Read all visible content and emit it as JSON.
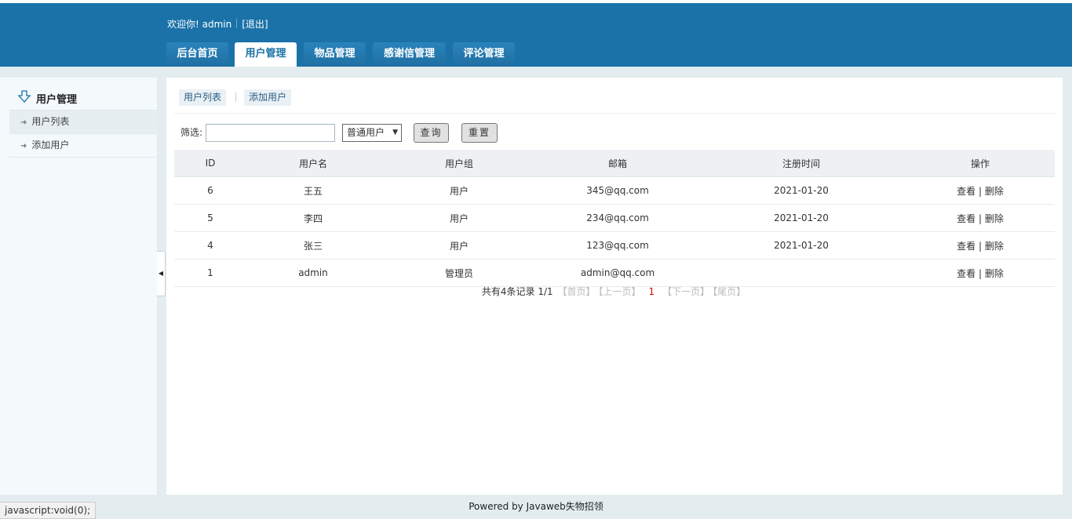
{
  "header": {
    "welcome": "欢迎你! admin",
    "logout": "[退出]",
    "tabs": [
      {
        "label": "后台首页"
      },
      {
        "label": "用户管理"
      },
      {
        "label": "物品管理"
      },
      {
        "label": "感谢信管理"
      },
      {
        "label": "评论管理"
      }
    ],
    "active_tab": "用户管理"
  },
  "sidebar": {
    "title": "用户管理",
    "items": [
      {
        "label": "用户列表"
      },
      {
        "label": "添加用户"
      }
    ]
  },
  "main": {
    "subtabs": [
      {
        "label": "用户列表"
      },
      {
        "label": "添加用户"
      }
    ],
    "filter": {
      "label": "筛选:",
      "input_value": "",
      "select_value": "普通用户",
      "query_button": "查询",
      "reset_button": "重置"
    },
    "table": {
      "columns": [
        "ID",
        "用户名",
        "用户组",
        "邮箱",
        "注册时间",
        "操作"
      ],
      "rows": [
        {
          "id": "6",
          "username": "王五",
          "group": "用户",
          "email": "345@qq.com",
          "date": "2021-01-20"
        },
        {
          "id": "5",
          "username": "李四",
          "group": "用户",
          "email": "234@qq.com",
          "date": "2021-01-20"
        },
        {
          "id": "4",
          "username": "张三",
          "group": "用户",
          "email": "123@qq.com",
          "date": "2021-01-20"
        },
        {
          "id": "1",
          "username": "admin",
          "group": "管理员",
          "email": "admin@qq.com",
          "date": ""
        }
      ],
      "action_view": "查看",
      "action_sep": "|",
      "action_delete": "删除"
    },
    "pager": {
      "summary": "共有4条记录",
      "pages": "1/1",
      "first": "【首页】",
      "prev": "【上一页】",
      "current": "1",
      "next": "【下一页】",
      "last": "【尾页】"
    }
  },
  "footer": {
    "text": "Powered by Javaweb失物招领"
  },
  "statusbar": {
    "text": "javascript:void(0);"
  }
}
